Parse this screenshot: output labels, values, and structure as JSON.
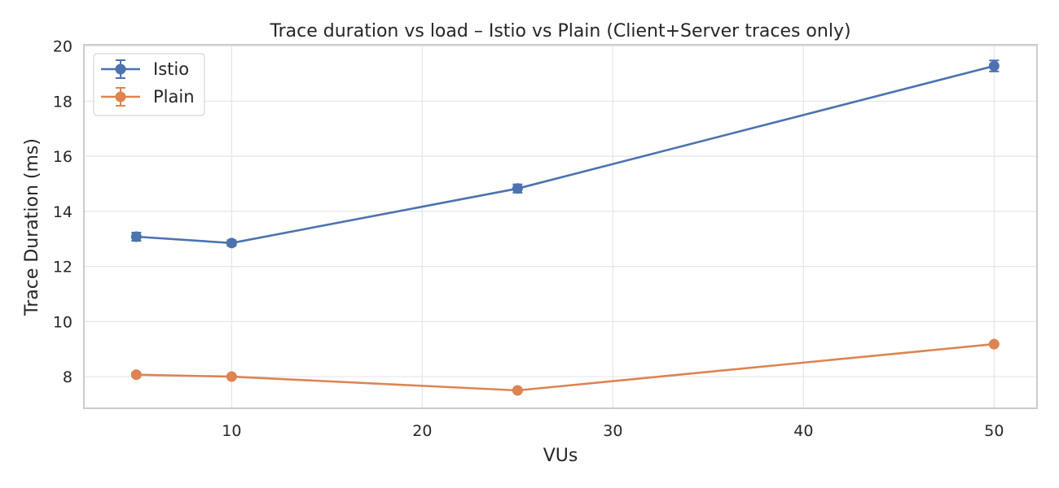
{
  "chart_data": {
    "type": "line",
    "title": "Trace duration vs load – Istio vs Plain (Client+Server traces only)",
    "xlabel": "VUs",
    "ylabel": "Trace Duration (ms)",
    "x": [
      5,
      10,
      25,
      50
    ],
    "xlim": [
      2.25,
      52.25
    ],
    "ylim": [
      6.85,
      20.05
    ],
    "xticks": [
      10,
      20,
      30,
      40,
      50
    ],
    "yticks": [
      8,
      10,
      12,
      14,
      16,
      18,
      20
    ],
    "grid": true,
    "legend_position": "top-left",
    "series": [
      {
        "name": "Istio",
        "color": "#4c72b0",
        "values": [
          13.08,
          12.85,
          14.83,
          19.28
        ],
        "errors": [
          0.15,
          0.1,
          0.15,
          0.2
        ]
      },
      {
        "name": "Plain",
        "color": "#dd8452",
        "values": [
          8.07,
          8.0,
          7.5,
          9.18
        ],
        "errors": [
          0.08,
          0.05,
          0.05,
          0.05
        ]
      }
    ]
  }
}
